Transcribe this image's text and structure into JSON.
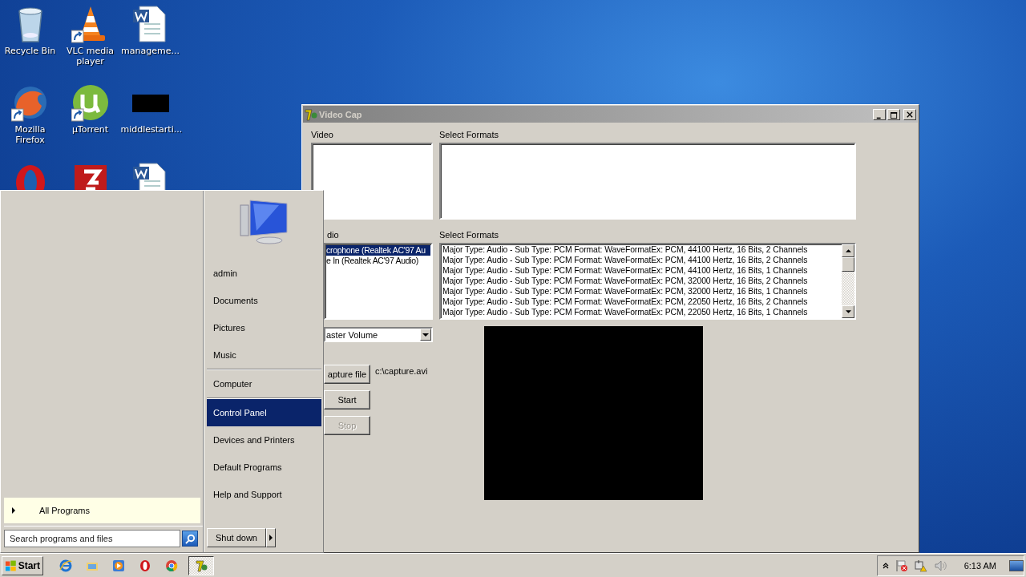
{
  "desktop_icons": [
    {
      "kind": "bin",
      "label": "Recycle Bin",
      "shortcut": false
    },
    {
      "kind": "cone",
      "label": "VLC media player",
      "shortcut": true
    },
    {
      "kind": "document",
      "label": "manageme...",
      "shortcut": false
    },
    {
      "kind": "globe",
      "label": "Mozilla Firefox",
      "shortcut": true
    },
    {
      "kind": "torrent",
      "label": "µTorrent",
      "shortcut": true
    },
    {
      "kind": "thumbnail",
      "label": "middlestarti...",
      "shortcut": false
    },
    {
      "kind": "ring",
      "shortcut": false
    },
    {
      "kind": "ftp",
      "shortcut": false
    },
    {
      "kind": "document",
      "shortcut": false
    }
  ],
  "window": {
    "title": "Video Cap",
    "video_label": "Video",
    "video_formats_label": "Select Formats",
    "audio_label": "dio",
    "audio_formats_label": "Select Formats",
    "audio_devices": [
      {
        "label": "crophone (Realtek AC'97 Au",
        "selected": true
      },
      {
        "label": "e In (Realtek AC'97 Audio)",
        "selected": false
      }
    ],
    "audio_formats": [
      "Major Type: Audio - Sub Type: PCM Format: WaveFormatEx: PCM, 44100 Hertz, 16 Bits, 2 Channels",
      "Major Type: Audio - Sub Type: PCM Format: WaveFormatEx: PCM, 44100 Hertz, 16 Bits, 2 Channels",
      "Major Type: Audio - Sub Type: PCM Format: WaveFormatEx: PCM, 44100 Hertz, 16 Bits, 1 Channels",
      "Major Type: Audio - Sub Type: PCM Format: WaveFormatEx: PCM, 32000 Hertz, 16 Bits, 2 Channels",
      "Major Type: Audio - Sub Type: PCM Format: WaveFormatEx: PCM, 32000 Hertz, 16 Bits, 1 Channels",
      "Major Type: Audio - Sub Type: PCM Format: WaveFormatEx: PCM, 22050 Hertz, 16 Bits, 2 Channels",
      "Major Type: Audio - Sub Type: PCM Format: WaveFormatEx: PCM, 22050 Hertz, 16 Bits, 1 Channels"
    ],
    "mixer_dropdown": {
      "value": "aster Volume"
    },
    "capture_file_button": "apture file",
    "capture_path": "c:\\capture.avi",
    "start_button": {
      "label": "Start",
      "disabled": false
    },
    "stop_button": {
      "label": "Stop",
      "disabled": true
    }
  },
  "start_menu": {
    "all_programs": "All Programs",
    "search": {
      "placeholder": "Search programs and files"
    },
    "shut_down": "Shut down",
    "item_groups": [
      [
        {
          "label": "admin",
          "selected": false
        },
        {
          "label": "Documents",
          "selected": false
        },
        {
          "label": "Pictures",
          "selected": false
        },
        {
          "label": "Music",
          "selected": false
        }
      ],
      [
        {
          "label": "Computer",
          "selected": false
        }
      ],
      [
        {
          "label": "Control Panel",
          "selected": true
        },
        {
          "label": "Devices and Printers",
          "selected": false
        },
        {
          "label": "Default Programs",
          "selected": false
        },
        {
          "label": "Help and Support",
          "selected": false
        }
      ]
    ]
  },
  "taskbar": {
    "start": "Start",
    "apps": [
      {
        "kind": "browser",
        "selected": false
      },
      {
        "kind": "folder",
        "selected": false
      },
      {
        "kind": "player",
        "selected": false
      },
      {
        "kind": "ring",
        "selected": false
      },
      {
        "kind": "chrome",
        "selected": false
      },
      {
        "kind": "capture",
        "selected": true
      }
    ],
    "clock": "6:13 AM"
  }
}
